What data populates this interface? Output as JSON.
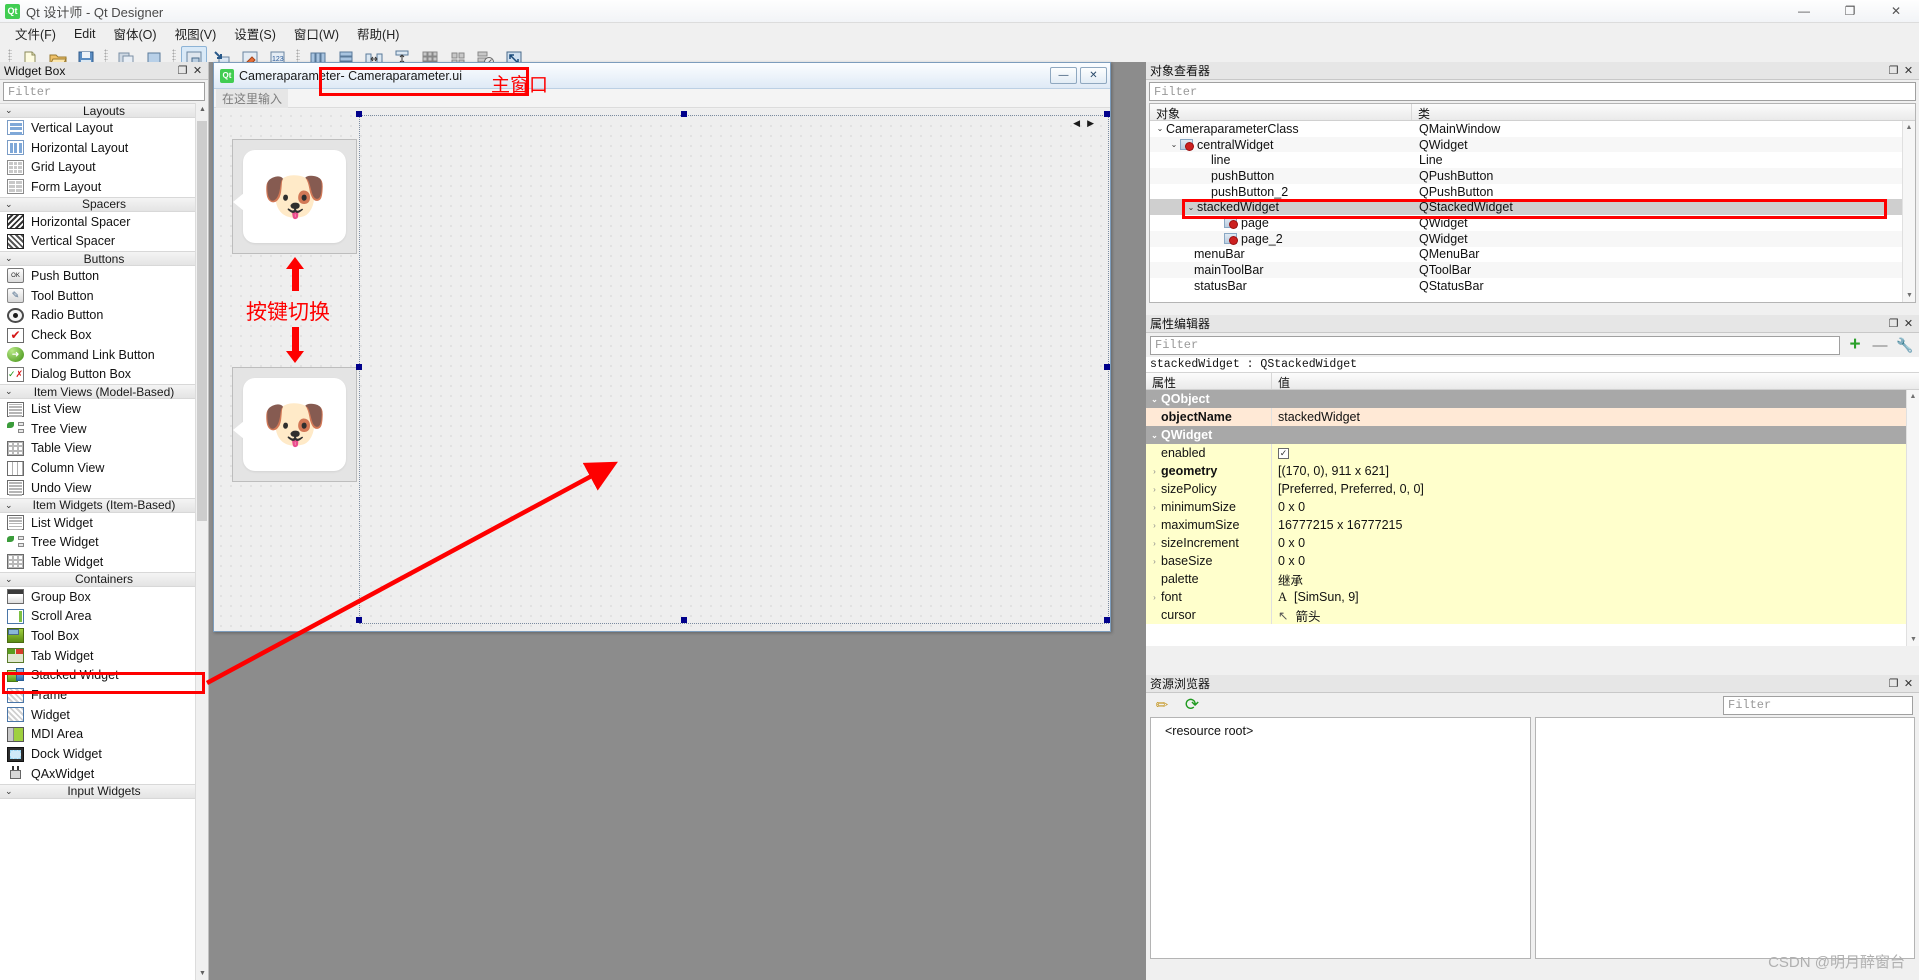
{
  "window": {
    "title": "Qt 设计师 - Qt Designer",
    "logo": "Qt",
    "minimize": "—",
    "maximize": "❐",
    "close": "✕"
  },
  "menubar": {
    "items": [
      {
        "label": "文件(F)"
      },
      {
        "label": "Edit"
      },
      {
        "label": "窗体(O)"
      },
      {
        "label": "视图(V)"
      },
      {
        "label": "设置(S)"
      },
      {
        "label": "窗口(W)"
      },
      {
        "label": "帮助(H)"
      }
    ]
  },
  "toolbar": {
    "groups": [
      {
        "buttons": [
          {
            "name": "new-form-icon",
            "glyph": "📄"
          },
          {
            "name": "open-form-icon",
            "glyph": "📂"
          },
          {
            "name": "save-form-icon",
            "glyph": "💾"
          }
        ]
      },
      {
        "buttons": [
          {
            "name": "undo-icon",
            "glyph": "❐"
          },
          {
            "name": "redo-icon",
            "glyph": "▢"
          }
        ]
      },
      {
        "buttons": [
          {
            "name": "edit-widgets-mode-icon",
            "glyph": "⊞",
            "active": true
          },
          {
            "name": "edit-signals-slots-mode-icon",
            "glyph": "↘"
          },
          {
            "name": "edit-buddies-mode-icon",
            "glyph": "◈"
          },
          {
            "name": "edit-tab-order-mode-icon",
            "glyph": "123"
          }
        ]
      },
      {
        "buttons": [
          {
            "name": "layout-horizontally-icon",
            "glyph": "|||"
          },
          {
            "name": "layout-vertically-icon",
            "glyph": "☰"
          },
          {
            "name": "layout-in-splitter-h-icon",
            "glyph": "↔"
          },
          {
            "name": "layout-in-splitter-v-icon",
            "glyph": "↕"
          },
          {
            "name": "layout-grid-icon",
            "glyph": "▦"
          },
          {
            "name": "layout-form-icon",
            "glyph": "▤"
          },
          {
            "name": "break-layout-icon",
            "glyph": "⊘"
          },
          {
            "name": "adjust-size-icon",
            "glyph": "⤡"
          }
        ]
      }
    ]
  },
  "widget_box": {
    "title": "Widget Box",
    "filter_placeholder": "Filter",
    "float_btn": "❐",
    "close_btn": "✕",
    "groups": [
      {
        "label": "Layouts",
        "chevron": "⌄",
        "items": [
          {
            "label": "Vertical Layout",
            "icon": "vertical-layout-icon"
          },
          {
            "label": "Horizontal Layout",
            "icon": "horizontal-layout-icon"
          },
          {
            "label": "Grid Layout",
            "icon": "grid-layout-icon"
          },
          {
            "label": "Form Layout",
            "icon": "form-layout-icon"
          }
        ]
      },
      {
        "label": "Spacers",
        "chevron": "⌄",
        "items": [
          {
            "label": "Horizontal Spacer",
            "icon": "horizontal-spacer-icon"
          },
          {
            "label": "Vertical Spacer",
            "icon": "vertical-spacer-icon"
          }
        ]
      },
      {
        "label": "Buttons",
        "chevron": "⌄",
        "items": [
          {
            "label": "Push Button",
            "icon": "push-button-icon"
          },
          {
            "label": "Tool Button",
            "icon": "tool-button-icon"
          },
          {
            "label": "Radio Button",
            "icon": "radio-button-icon"
          },
          {
            "label": "Check Box",
            "icon": "check-box-icon"
          },
          {
            "label": "Command Link Button",
            "icon": "command-link-button-icon"
          },
          {
            "label": "Dialog Button Box",
            "icon": "dialog-button-box-icon"
          }
        ]
      },
      {
        "label": "Item Views (Model-Based)",
        "chevron": "⌄",
        "items": [
          {
            "label": "List View",
            "icon": "list-view-icon"
          },
          {
            "label": "Tree View",
            "icon": "tree-view-icon"
          },
          {
            "label": "Table View",
            "icon": "table-view-icon"
          },
          {
            "label": "Column View",
            "icon": "column-view-icon"
          },
          {
            "label": "Undo View",
            "icon": "undo-view-icon"
          }
        ]
      },
      {
        "label": "Item Widgets (Item-Based)",
        "chevron": "⌄",
        "items": [
          {
            "label": "List Widget",
            "icon": "list-widget-icon"
          },
          {
            "label": "Tree Widget",
            "icon": "tree-widget-icon"
          },
          {
            "label": "Table Widget",
            "icon": "table-widget-icon"
          }
        ]
      },
      {
        "label": "Containers",
        "chevron": "⌄",
        "items": [
          {
            "label": "Group Box",
            "icon": "group-box-icon"
          },
          {
            "label": "Scroll Area",
            "icon": "scroll-area-icon"
          },
          {
            "label": "Tool Box",
            "icon": "tool-box-icon"
          },
          {
            "label": "Tab Widget",
            "icon": "tab-widget-icon"
          },
          {
            "label": "Stacked Widget",
            "icon": "stacked-widget-icon",
            "highlighted": true
          },
          {
            "label": "Frame",
            "icon": "frame-icon"
          },
          {
            "label": "Widget",
            "icon": "widget-icon"
          },
          {
            "label": "MDI Area",
            "icon": "mdi-area-icon"
          },
          {
            "label": "Dock Widget",
            "icon": "dock-widget-icon"
          },
          {
            "label": "QAxWidget",
            "icon": "qaxwidget-icon"
          }
        ]
      },
      {
        "label": "Input Widgets",
        "chevron": "⌄",
        "items": []
      }
    ]
  },
  "form_window": {
    "logo": "Qt",
    "title_prefix": "Cameraparameter",
    "title_file": " - Cameraparameter.ui",
    "menu_placeholder": "在这里输入",
    "minimize": "—",
    "close": "✕",
    "annotation_main_window": "主窗口",
    "annotation_switch": "按键切换",
    "page_one_emoji": "🐶",
    "page_two_emoji": "🐶",
    "nav_left": "◀",
    "nav_right": "▶"
  },
  "object_inspector": {
    "title": "对象查看器",
    "filter_placeholder": "Filter",
    "float_btn": "❐",
    "close_btn": "✕",
    "columns": [
      "对象",
      "类"
    ],
    "rows": [
      {
        "name": "CameraparameterClass",
        "class": "QMainWindow",
        "indent": 0,
        "twisty": "⌄",
        "icon": false
      },
      {
        "name": "centralWidget",
        "class": "QWidget",
        "indent": 1,
        "twisty": "⌄",
        "icon": true
      },
      {
        "name": "line",
        "class": "Line",
        "indent": 2,
        "twisty": "",
        "icon": false
      },
      {
        "name": "pushButton",
        "class": "QPushButton",
        "indent": 2,
        "twisty": "",
        "icon": false
      },
      {
        "name": "pushButton_2",
        "class": "QPushButton",
        "indent": 2,
        "twisty": "",
        "icon": false
      },
      {
        "name": "stackedWidget",
        "class": "QStackedWidget",
        "indent": 2,
        "twisty": "⌄",
        "icon": false,
        "selected": true
      },
      {
        "name": "page",
        "class": "QWidget",
        "indent": 3,
        "twisty": "",
        "icon": true
      },
      {
        "name": "page_2",
        "class": "QWidget",
        "indent": 3,
        "twisty": "",
        "icon": true
      },
      {
        "name": "menuBar",
        "class": "QMenuBar",
        "indent": 1,
        "twisty": "",
        "icon": false
      },
      {
        "name": "mainToolBar",
        "class": "QToolBar",
        "indent": 1,
        "twisty": "",
        "icon": false
      },
      {
        "name": "statusBar",
        "class": "QStatusBar",
        "indent": 1,
        "twisty": "",
        "icon": false
      }
    ]
  },
  "property_editor": {
    "title": "属性编辑器",
    "filter_placeholder": "Filter",
    "float_btn": "❐",
    "close_btn": "✕",
    "add_icon": "+",
    "remove_icon": "—",
    "config_icon": "🔧",
    "object_line": "stackedWidget : QStackedWidget",
    "columns": [
      "属性",
      "值"
    ],
    "rows": [
      {
        "kind": "group",
        "name": "QObject",
        "value": "",
        "twisty": "⌄"
      },
      {
        "kind": "name",
        "name": "objectName",
        "value": "stackedWidget",
        "twisty": ""
      },
      {
        "kind": "group",
        "name": "QWidget",
        "value": "",
        "twisty": "⌄"
      },
      {
        "kind": "prop",
        "name": "enabled",
        "value": "",
        "twisty": "",
        "checkbox": true
      },
      {
        "kind": "prop",
        "name": "geometry",
        "value": "[(170, 0), 911 x 621]",
        "twisty": "›",
        "bold": true
      },
      {
        "kind": "prop",
        "name": "sizePolicy",
        "value": "[Preferred, Preferred, 0, 0]",
        "twisty": "›"
      },
      {
        "kind": "prop",
        "name": "minimumSize",
        "value": "0 x 0",
        "twisty": "›"
      },
      {
        "kind": "prop",
        "name": "maximumSize",
        "value": "16777215 x 16777215",
        "twisty": "›"
      },
      {
        "kind": "prop",
        "name": "sizeIncrement",
        "value": "0 x 0",
        "twisty": "›"
      },
      {
        "kind": "prop",
        "name": "baseSize",
        "value": "0 x 0",
        "twisty": "›"
      },
      {
        "kind": "prop",
        "name": "palette",
        "value": "继承",
        "twisty": ""
      },
      {
        "kind": "prop",
        "name": "font",
        "value": "[SimSun, 9]",
        "twisty": "›",
        "prefix": "A"
      },
      {
        "kind": "prop",
        "name": "cursor",
        "value": "箭头",
        "twisty": "",
        "prefix": "↖"
      }
    ]
  },
  "resource_browser": {
    "title": "资源浏览器",
    "filter_placeholder": "Filter",
    "float_btn": "❐",
    "close_btn": "✕",
    "edit_icon": "✏",
    "reload_icon": "⟳",
    "root_label": "<resource root>"
  },
  "watermark": "CSDN @明月醉窗台",
  "colors": {
    "annotation_red": "#fe0000",
    "selection_gray": "#cfcfcf",
    "prop_yellow": "#ffffcc",
    "prop_orange": "#ffe9d6",
    "qt_green": "#41cd52"
  }
}
